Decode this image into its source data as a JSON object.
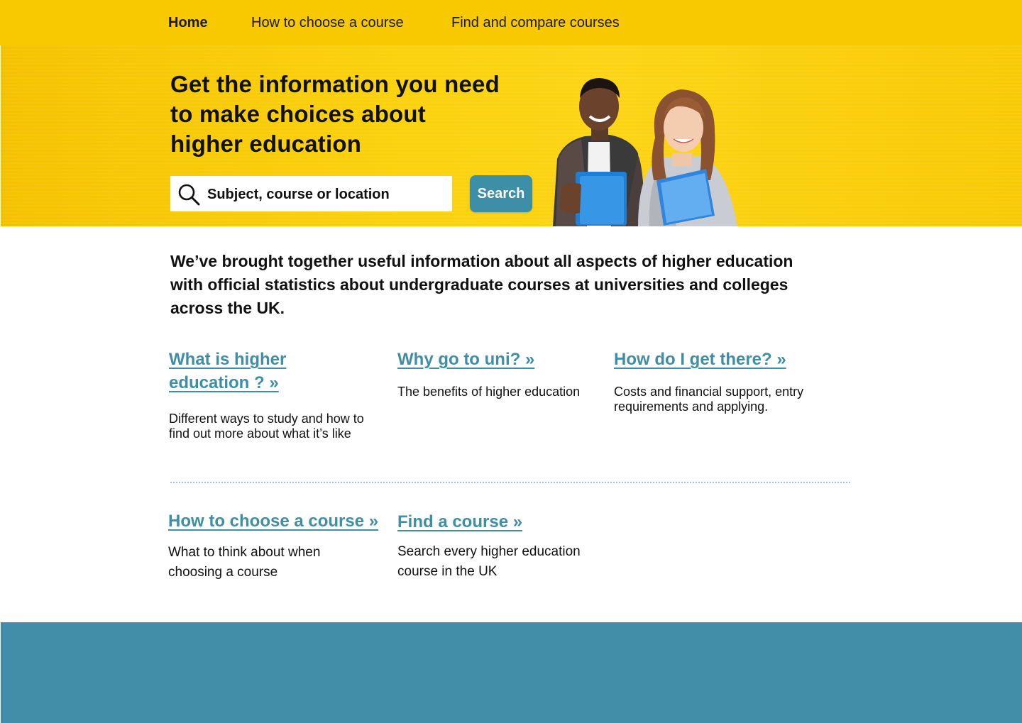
{
  "nav": {
    "home": "Home",
    "choose": "How to choose a course",
    "find": "Find and compare courses"
  },
  "hero": {
    "title": "Get the information you need to make choices about higher education",
    "search_placeholder": "Subject, course or location",
    "search_button": "Search"
  },
  "intro": "We’ve brought together useful information about all aspects of higher education with official statistics about undergraduate courses at universities and colleges across the UK.",
  "cards": [
    {
      "title": "What is higher education ? »",
      "description": "Different ways to study and how to find out more about what it’s like"
    },
    {
      "title": "Why go to uni? »",
      "description": "The benefits of higher education"
    },
    {
      "title": "How do I get there? »",
      "description": "Costs and financial support, entry requirements and applying."
    },
    {
      "title": "How to choose a course »",
      "description": "What to think about when choosing a course"
    },
    {
      "title": "Find a course »",
      "description": "Search every higher education course in the UK"
    }
  ],
  "colors": {
    "brand_yellow": "#f8c900",
    "accent_teal": "#3f8ea6",
    "footer_teal": "#428da7"
  },
  "icons": {
    "search": "search-icon",
    "hero_image": "students-photo"
  }
}
